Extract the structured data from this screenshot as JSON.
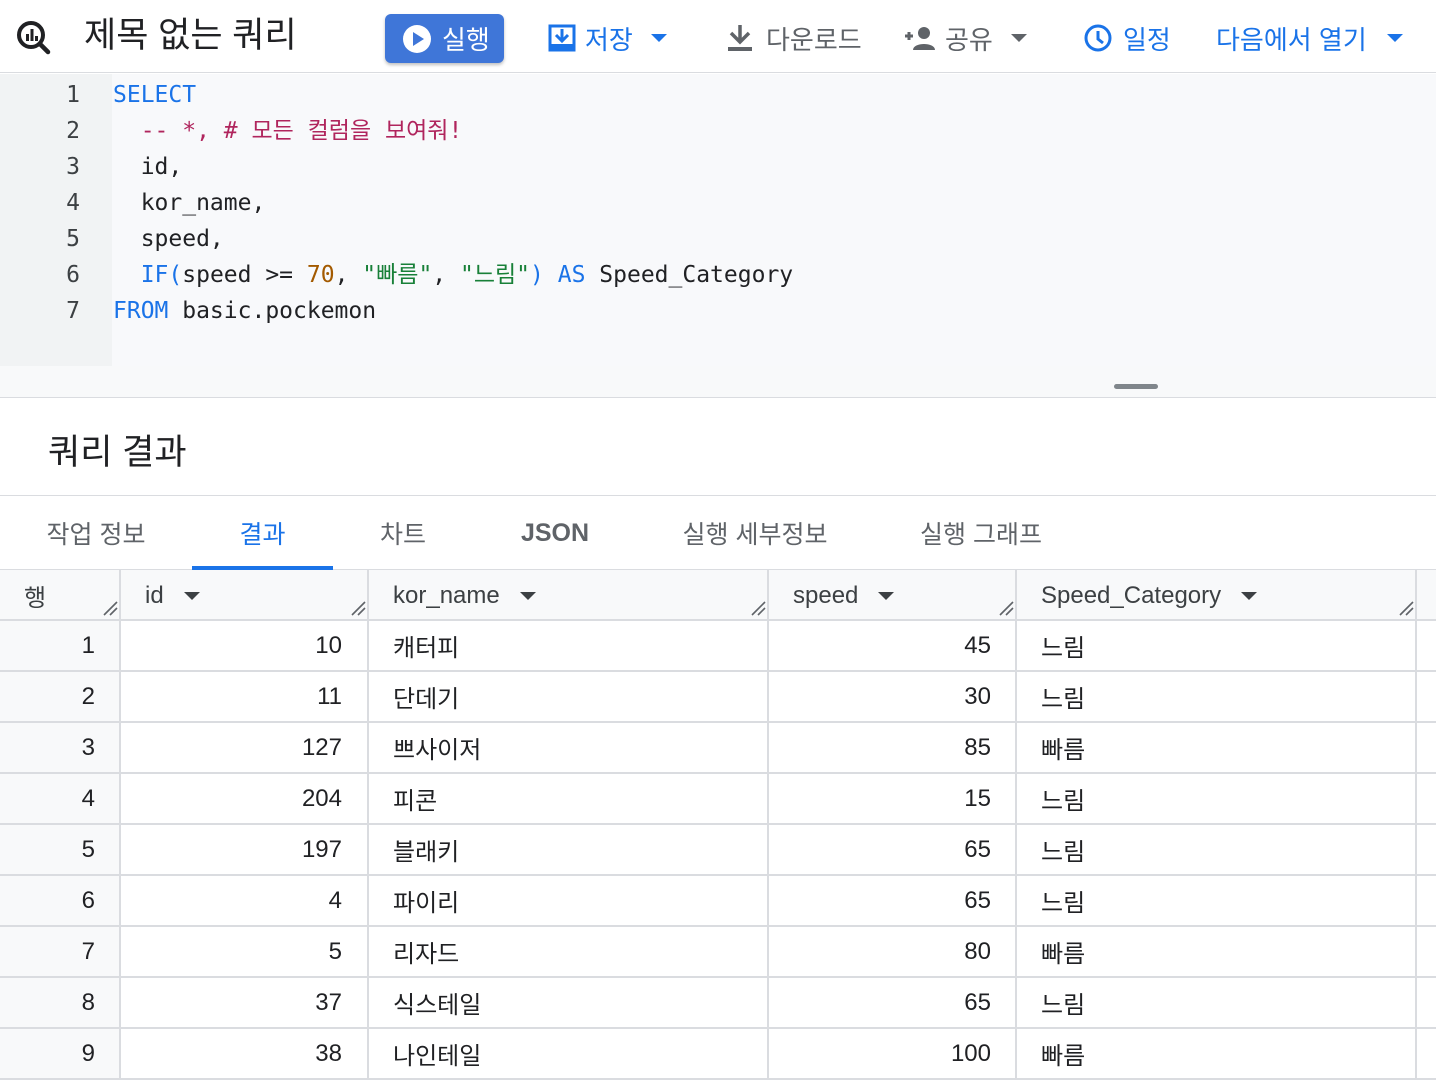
{
  "toolbar": {
    "title": "제목 없는 쿼리",
    "run_label": "실행",
    "save_label": "저장",
    "download_label": "다운로드",
    "share_label": "공유",
    "schedule_label": "일정",
    "open_in_label": "다음에서 열기"
  },
  "editor": {
    "lines": [
      {
        "num": "1",
        "tokens": [
          {
            "t": "SELECT",
            "c": "kw"
          }
        ]
      },
      {
        "num": "2",
        "tokens": [
          {
            "t": "  -- *, # 모든 컬럼을 보여줘!",
            "c": "cm"
          }
        ]
      },
      {
        "num": "3",
        "tokens": [
          {
            "t": "  id,",
            "c": ""
          }
        ]
      },
      {
        "num": "4",
        "tokens": [
          {
            "t": "  kor_name,",
            "c": ""
          }
        ]
      },
      {
        "num": "5",
        "tokens": [
          {
            "t": "  speed,",
            "c": ""
          }
        ]
      },
      {
        "num": "6",
        "tokens": [
          {
            "t": "  ",
            "c": ""
          },
          {
            "t": "IF(",
            "c": "kw"
          },
          {
            "t": "speed >= ",
            "c": ""
          },
          {
            "t": "70",
            "c": "num"
          },
          {
            "t": ", ",
            "c": ""
          },
          {
            "t": "\"빠름\"",
            "c": "str"
          },
          {
            "t": ", ",
            "c": ""
          },
          {
            "t": "\"느림\"",
            "c": "str"
          },
          {
            "t": ")",
            "c": "kw"
          },
          {
            "t": " ",
            "c": ""
          },
          {
            "t": "AS",
            "c": "kw"
          },
          {
            "t": " Speed_Category",
            "c": ""
          }
        ]
      },
      {
        "num": "7",
        "tokens": [
          {
            "t": "FROM",
            "c": "kw"
          },
          {
            "t": " basic.pockemon",
            "c": ""
          }
        ]
      }
    ]
  },
  "results": {
    "title": "쿼리 결과",
    "tabs": [
      "작업 정보",
      "결과",
      "차트",
      "JSON",
      "실행 세부정보",
      "실행 그래프"
    ],
    "active_tab": "결과",
    "columns": [
      "행",
      "id",
      "kor_name",
      "speed",
      "Speed_Category"
    ],
    "rows": [
      [
        "1",
        "10",
        "캐터피",
        "45",
        "느림"
      ],
      [
        "2",
        "11",
        "단데기",
        "30",
        "느림"
      ],
      [
        "3",
        "127",
        "쁘사이저",
        "85",
        "빠름"
      ],
      [
        "4",
        "204",
        "피콘",
        "15",
        "느림"
      ],
      [
        "5",
        "197",
        "블래키",
        "65",
        "느림"
      ],
      [
        "6",
        "4",
        "파이리",
        "65",
        "느림"
      ],
      [
        "7",
        "5",
        "리자드",
        "80",
        "빠름"
      ],
      [
        "8",
        "37",
        "식스테일",
        "65",
        "느림"
      ],
      [
        "9",
        "38",
        "나인테일",
        "100",
        "빠름"
      ]
    ]
  },
  "icons": {
    "logo": "bigquery-magnifier-icon",
    "run": "play-circle-icon",
    "save": "save-icon",
    "download": "download-icon",
    "share": "person-add-icon",
    "schedule": "clock-icon",
    "dropdown": "caret-down-icon"
  },
  "colors": {
    "primary": "#1a73e8",
    "run_button": "#3f76d8",
    "keyword": "#1a73e8",
    "comment": "#b0255d",
    "number": "#a35a00",
    "string": "#188038"
  }
}
